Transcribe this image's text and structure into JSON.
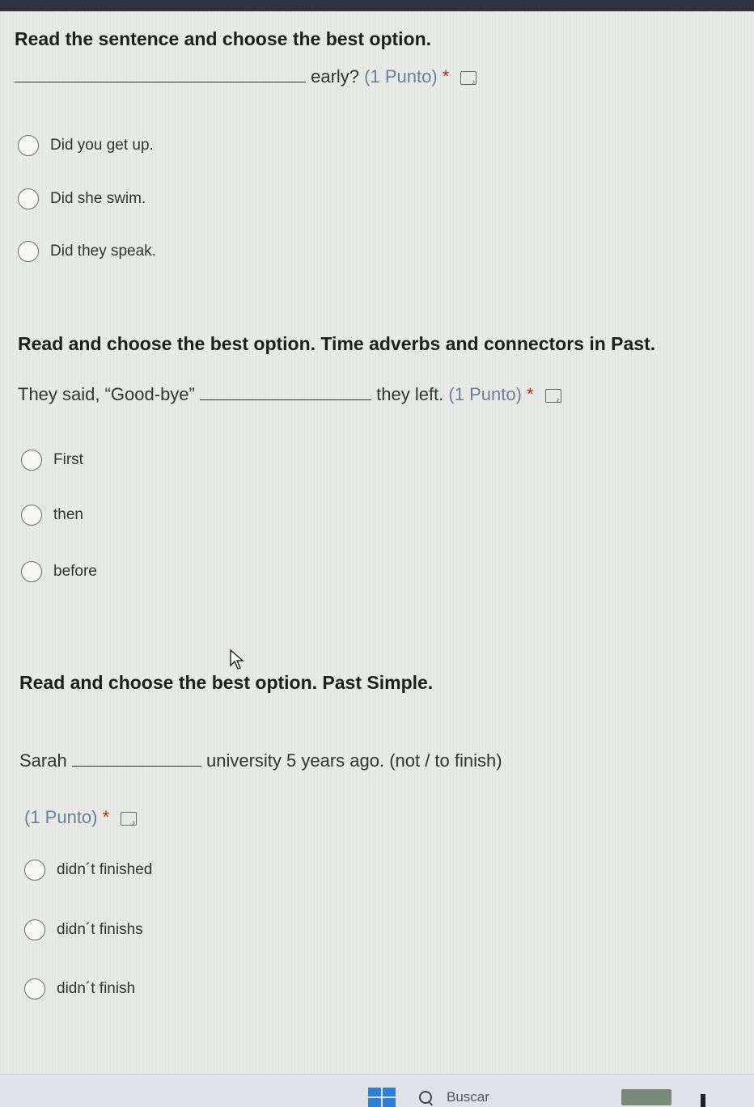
{
  "questions": [
    {
      "heading": "Read the sentence and choose the best option.",
      "prompt_after": "early?",
      "points": "(1 Punto)",
      "required_mark": "*",
      "options": [
        "Did you get up.",
        "Did she swim.",
        "Did they speak."
      ]
    },
    {
      "heading": "Read and choose the best option. Time adverbs and connectors in Past.",
      "prompt_before": "They said, “Good-bye”",
      "prompt_after": "they left.",
      "points": "(1 Punto)",
      "required_mark": "*",
      "options": [
        "First",
        "then",
        "before"
      ]
    },
    {
      "heading": "Read and choose the best option. Past Simple.",
      "prompt_before": "Sarah",
      "prompt_after": "university 5 years ago. (not / to finish)",
      "points": "(1 Punto)",
      "required_mark": "*",
      "options": [
        "didn´t finished",
        "didn´t finishs",
        "didn´t finish"
      ]
    }
  ],
  "taskbar": {
    "search_label": "Buscar"
  },
  "icons": {
    "audio": "immersive-reader-icon",
    "start": "windows-start-icon",
    "search": "search-icon",
    "cursor": "mouse-cursor-icon"
  }
}
